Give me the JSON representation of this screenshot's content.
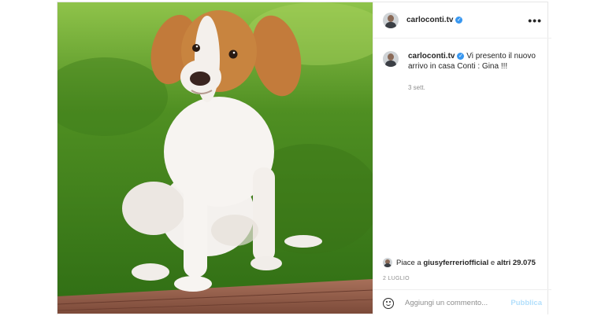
{
  "post": {
    "username": "carloconti.tv",
    "verified_icon": "verified-badge-icon",
    "more_icon": "more-options-icon",
    "more_label": "•••",
    "caption": "Vi presento il nuovo arrivo in casa Conti : Gina !!!",
    "caption_time": "3 sett.",
    "likes": {
      "prefix": "Piace a ",
      "user": "giusyferreriofficial",
      "middle": " e ",
      "others": "altri 29.075"
    },
    "date": "2 LUGLIO",
    "comment": {
      "placeholder": "Aggiungi un commento...",
      "value": "",
      "publish_label": "Pubblica",
      "emoji_icon": "emoji-icon"
    },
    "colors": {
      "verified": "#3897f0",
      "publish_disabled": "#b2dffc",
      "meta_text": "#8e8e8e"
    }
  }
}
